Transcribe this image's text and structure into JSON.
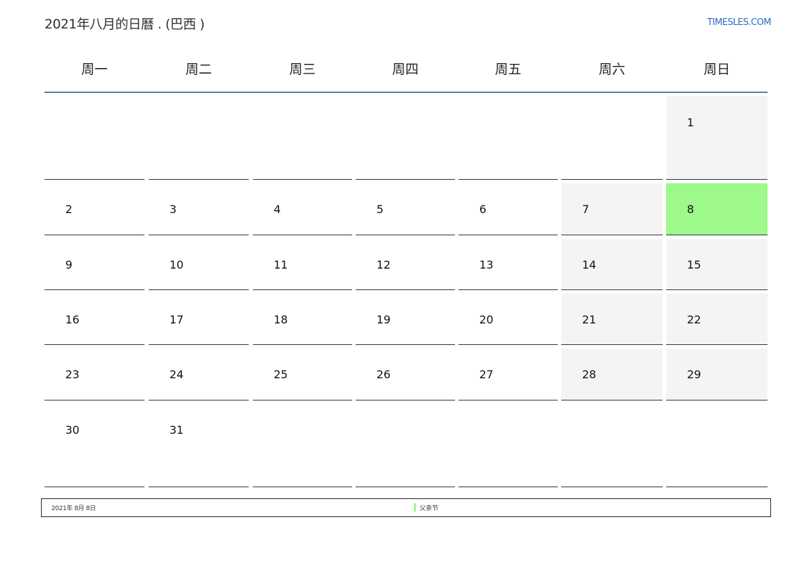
{
  "header": {
    "title": "2021年八月的日曆 . (巴西 )",
    "brand": "TIMESLES.COM"
  },
  "weekdays": [
    "周一",
    "周二",
    "周三",
    "周四",
    "周五",
    "周六",
    "周日"
  ],
  "weeks": [
    [
      "",
      "",
      "",
      "",
      "",
      "",
      "1"
    ],
    [
      "2",
      "3",
      "4",
      "5",
      "6",
      "7",
      "8"
    ],
    [
      "9",
      "10",
      "11",
      "12",
      "13",
      "14",
      "15"
    ],
    [
      "16",
      "17",
      "18",
      "19",
      "20",
      "21",
      "22"
    ],
    [
      "23",
      "24",
      "25",
      "26",
      "27",
      "28",
      "29"
    ],
    [
      "30",
      "31",
      "",
      "",
      "",
      "",
      ""
    ]
  ],
  "holiday_day": "8",
  "colors": {
    "holiday": "#9cf98a",
    "weekend": "#f4f4f4",
    "header_rule": "#5a7aa0",
    "brand": "#2a6ec1"
  },
  "footer": {
    "date": "2021年 8月 8日",
    "holiday_name": "父亲节"
  }
}
